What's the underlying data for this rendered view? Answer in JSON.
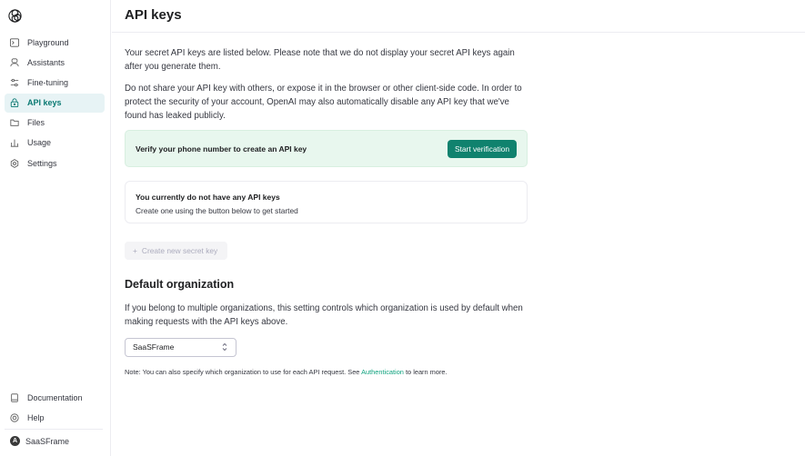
{
  "header": {
    "title": "API keys"
  },
  "sidebar": {
    "items": [
      {
        "label": "Playground",
        "icon": "terminal-icon",
        "active": false
      },
      {
        "label": "Assistants",
        "icon": "assistants-icon",
        "active": false
      },
      {
        "label": "Fine-tuning",
        "icon": "sliders-icon",
        "active": false
      },
      {
        "label": "API keys",
        "icon": "lock-icon",
        "active": true
      },
      {
        "label": "Files",
        "icon": "folder-icon",
        "active": false
      },
      {
        "label": "Usage",
        "icon": "bar-chart-icon",
        "active": false
      },
      {
        "label": "Settings",
        "icon": "gear-icon",
        "active": false
      }
    ],
    "bottom_items": [
      {
        "label": "Documentation",
        "icon": "book-icon"
      },
      {
        "label": "Help",
        "icon": "help-icon"
      }
    ],
    "org": {
      "avatar_letter": "A",
      "name": "SaaSFrame"
    }
  },
  "main": {
    "intro": "Your secret API keys are listed below. Please note that we do not display your secret API keys again after you generate them.",
    "warning": "Do not share your API key with others, or expose it in the browser or other client-side code. In order to protect the security of your account, OpenAI may also automatically disable any API key that we've found has leaked publicly.",
    "verify": {
      "text": "Verify your phone number to create an API key",
      "button": "Start verification"
    },
    "empty": {
      "title": "You currently do not have any API keys",
      "subtitle": "Create one using the button below to get started"
    },
    "create_button": "Create new secret key",
    "default_org": {
      "title": "Default organization",
      "description": "If you belong to multiple organizations, this setting controls which organization is used by default when making requests with the API keys above.",
      "selected": "SaaSFrame",
      "note_before": "Note: You can also specify which organization to use for each API request. See ",
      "note_link": "Authentication",
      "note_after": " to learn more."
    }
  },
  "colors": {
    "accent": "#10826e",
    "active_bg": "#e7f3f5",
    "verify_bg": "#e8f7ee",
    "link": "#10a37f"
  }
}
